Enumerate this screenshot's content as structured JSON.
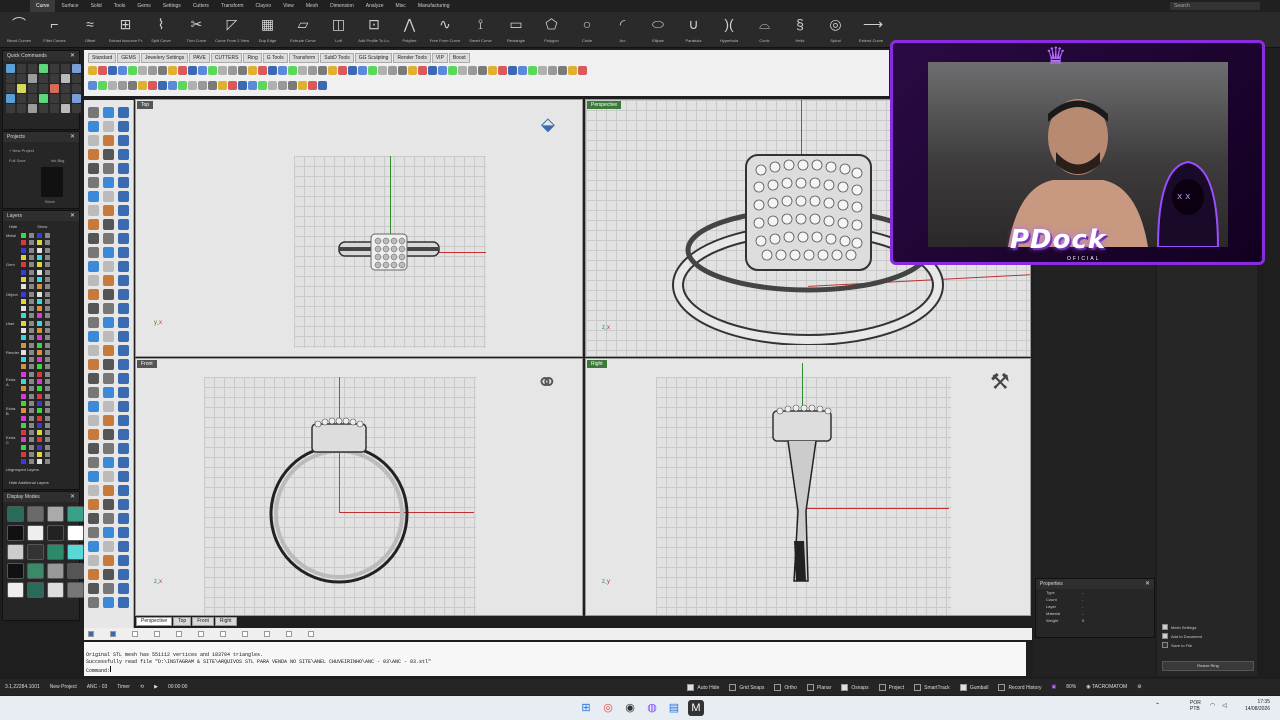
{
  "menu_tabs": [
    "Curve",
    "Surface",
    "Solid",
    "Tools",
    "Gems",
    "Settings",
    "Cutters",
    "Transform",
    "Clayoo",
    "View",
    "Mesh",
    "Dimension",
    "Analyze",
    "Misc",
    "Manufacturing"
  ],
  "search_placeholder": "Search",
  "ribbon": [
    {
      "label": "Blend Curves",
      "icon": "⌒"
    },
    {
      "label": "Fillet Curves",
      "icon": "⌐"
    },
    {
      "label": "Offset",
      "icon": "≈"
    },
    {
      "label": "Extract Isocurve Fr.",
      "icon": "⊞"
    },
    {
      "label": "Split Curve",
      "icon": "⌇"
    },
    {
      "label": "Trim Curve",
      "icon": "✂"
    },
    {
      "label": "Curve From 2 Views",
      "icon": "◸"
    },
    {
      "label": "Dup Edge",
      "icon": "▦"
    },
    {
      "label": "Extrude Curve",
      "icon": "▱"
    },
    {
      "label": "Loft",
      "icon": "◫"
    },
    {
      "label": "Add Profile To Lo.",
      "icon": "⊡"
    },
    {
      "label": "Polyline",
      "icon": "⋀"
    },
    {
      "label": "Free Form Curve",
      "icon": "∿"
    },
    {
      "label": "Smart Curve",
      "icon": "⟟"
    },
    {
      "label": "Rectangle",
      "icon": "▭"
    },
    {
      "label": "Polygon",
      "icon": "⬠"
    },
    {
      "label": "Circle",
      "icon": "○"
    },
    {
      "label": "Arc",
      "icon": "◜"
    },
    {
      "label": "Ellipse",
      "icon": "⬭"
    },
    {
      "label": "Parabola",
      "icon": "∪"
    },
    {
      "label": "Hyperbola",
      "icon": ")("
    },
    {
      "label": "Conic",
      "icon": "⌓"
    },
    {
      "label": "Helix",
      "icon": "§"
    },
    {
      "label": "Spiral",
      "icon": "◎"
    },
    {
      "label": "Extend Curve",
      "icon": "⟶"
    }
  ],
  "quick_commands_title": "Quick Commands",
  "projects_title": "Projects",
  "projects": {
    "new_project": "New Project",
    "full_save": "Full Save",
    "ink_bkg": "Ink Bkg",
    "blank": "Blank"
  },
  "layers_title": "Layers",
  "layers": {
    "hide": "Hide",
    "show": "Show",
    "ungrouped": "Ungrouped Layers",
    "hide_additional": "Hide Additional Layers",
    "groups": [
      "Metal",
      "Gem",
      "Object",
      "User",
      "Render",
      "Extra A",
      "Extra B",
      "Extra C"
    ]
  },
  "display_modes_title": "Display Modes",
  "rhino_tabs": [
    "Standard",
    "GEMS",
    "Jewelery Settings",
    "PAVE",
    "CUTTERS",
    "Ring",
    "G Tools",
    "Transform",
    "SubD Tools",
    "GG Sculpting",
    "Render Tools",
    "VIP",
    "Boost"
  ],
  "viewports": {
    "top": "Top",
    "perspective": "Perspective",
    "front": "Front",
    "right": "Right"
  },
  "viewport_tabs": [
    "Perspective",
    "Top",
    "Front",
    "Right"
  ],
  "command_history": [
    "Original STL mesh has 551112 vertices and 183704 triangles.",
    "Successfully read file \"D:\\INSTAGRAM & SITE\\ARQUIVOS STL PARA VENDA NO SITE\\ANEL CHUVEIRINHO\\ANC - 03\\ANC - 03.stl\""
  ],
  "command_prompt": "Command:",
  "webcam": {
    "brand": "PDock",
    "brand_sub": "OFICIAL"
  },
  "properties_title": "Properties",
  "properties": [
    "Type",
    "Count",
    "Layer",
    "Material",
    "Weight"
  ],
  "property_values": {
    "type": "-",
    "count": "-",
    "layer": "-",
    "material": "-",
    "weight": "0"
  },
  "mesh_settings": [
    {
      "label": "Mesh Settings",
      "checked": true
    },
    {
      "label": "Add to Document",
      "checked": true
    },
    {
      "label": "Save to File",
      "checked": false
    }
  ],
  "resize_ring": "Resize Ring",
  "status": {
    "coords": "3.1,22284.1001",
    "project": "New Project",
    "project_name": "ANC - 03",
    "timer_label": "Timer",
    "timer_value": "00:00:00",
    "toggles": [
      {
        "label": "Auto Hide",
        "on": true
      },
      {
        "label": "Grid Snaps",
        "on": false
      },
      {
        "label": "Ortho",
        "on": false
      },
      {
        "label": "Planar",
        "on": false
      },
      {
        "label": "Osnaps",
        "on": true
      },
      {
        "label": "Project",
        "on": false
      },
      {
        "label": "SmartTrack",
        "on": false
      },
      {
        "label": "Gumball",
        "on": true
      },
      {
        "label": "Record History",
        "on": false
      }
    ],
    "zoom": "80%",
    "user": "TACROMATOM"
  },
  "taskbar": {
    "lang": "POR PTB",
    "time": "17:35",
    "date": "14/08/2026"
  },
  "colors": {
    "accent": "#8a2be2",
    "axis_x": "#c03030",
    "axis_y": "#2e8b2e",
    "active_viewport": "#3c7a3c"
  }
}
